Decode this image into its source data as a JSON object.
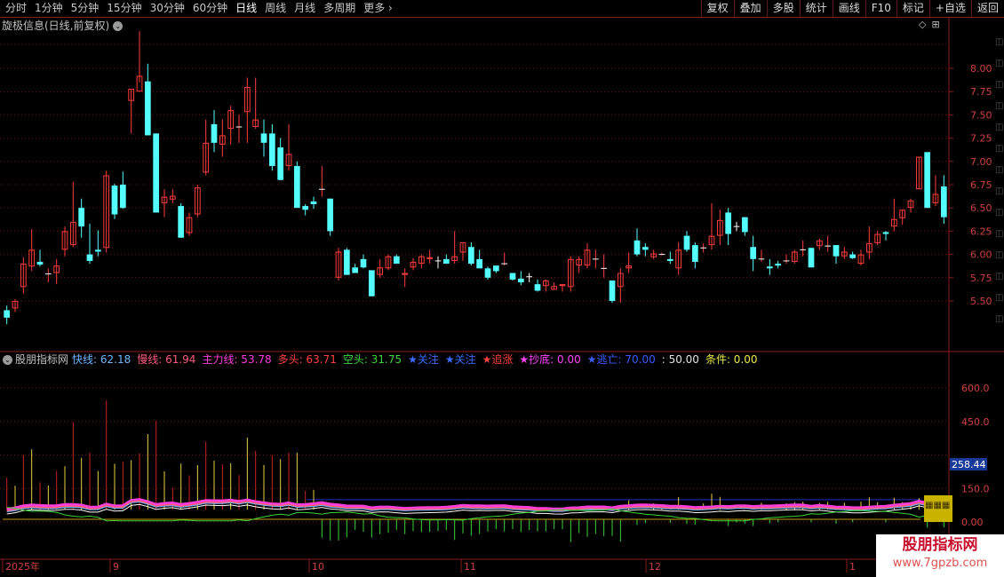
{
  "toolbar": {
    "periods": [
      "分时",
      "1分钟",
      "5分钟",
      "15分钟",
      "30分钟",
      "60分钟",
      "日线",
      "周线",
      "月线",
      "多周期",
      "更多"
    ],
    "active": "日线",
    "buttons": [
      "复权",
      "叠加",
      "多股",
      "统计",
      "画线",
      "F10",
      "标记",
      "+自选",
      "返回"
    ]
  },
  "main_title": "旋极信息(日线,前复权)",
  "main_tools": [
    "◇",
    "⊞"
  ],
  "price_axis": [
    "8.00",
    "7.75",
    "7.50",
    "7.25",
    "7.00",
    "6.75",
    "6.50",
    "6.25",
    "6.00",
    "5.75",
    "5.50"
  ],
  "indicator": {
    "name": "股朋指标网",
    "fields": [
      {
        "text": "快线: 62.18",
        "color": "#6fb7ff"
      },
      {
        "text": "慢线: 61.94",
        "color": "#ff5a7a"
      },
      {
        "text": "主力线: 53.78",
        "color": "#ff3ddc"
      },
      {
        "text": "多头: 63.71",
        "color": "#ff4040"
      },
      {
        "text": "空头: 31.75",
        "color": "#3dd43d"
      },
      {
        "text": "★关注",
        "color": "#3a6bff"
      },
      {
        "text": "★关注",
        "color": "#3a6bff"
      },
      {
        "text": "★追涨",
        "color": "#ff4040"
      },
      {
        "text": "★抄底: 0.00",
        "color": "#ff44ff"
      },
      {
        "text": "★逃亡: 70.00",
        "color": "#3a5cff"
      },
      {
        "text": ": 50.00",
        "color": "#e0e0e0"
      },
      {
        "text": "条件: 0.00",
        "color": "#e8e84a"
      }
    ],
    "axis": [
      "600.0",
      "450.0",
      "150.0",
      "0.00"
    ],
    "current_value": "258.44"
  },
  "dates": [
    "2025年",
    "9",
    "10",
    "11",
    "12",
    "1"
  ],
  "watermark": {
    "title": "股朋指标网",
    "url": "www.7gpzb.com"
  },
  "colors": {
    "up": "#ff3c3c",
    "down": "#54ffff",
    "grid": "#7a1010"
  },
  "chart_data": {
    "type": "candlestick",
    "y_range": [
      5.2,
      8.2
    ],
    "candles": [
      [
        5.4,
        5.45,
        5.25,
        5.32
      ],
      [
        5.42,
        5.52,
        5.38,
        5.5
      ],
      [
        5.65,
        5.97,
        5.58,
        5.9
      ],
      [
        5.87,
        6.27,
        5.82,
        6.05
      ],
      [
        5.92,
        6.05,
        5.87,
        5.89
      ],
      [
        5.79,
        5.85,
        5.7,
        5.79
      ],
      [
        5.8,
        5.95,
        5.68,
        5.88
      ],
      [
        6.05,
        6.3,
        5.98,
        6.25
      ],
      [
        6.1,
        6.78,
        6.08,
        6.35
      ],
      [
        6.5,
        6.6,
        6.18,
        6.3
      ],
      [
        6.0,
        6.33,
        5.9,
        5.93
      ],
      [
        6.05,
        6.26,
        5.98,
        6.03
      ],
      [
        6.07,
        6.9,
        6.02,
        6.85
      ],
      [
        6.74,
        6.76,
        6.38,
        6.43
      ],
      [
        6.75,
        6.89,
        6.49,
        6.5
      ],
      [
        7.65,
        7.77,
        7.3,
        7.78
      ],
      [
        7.75,
        8.4,
        7.85,
        7.92
      ],
      [
        7.86,
        8.05,
        7.28,
        7.28
      ],
      [
        7.3,
        7.3,
        6.45,
        6.45
      ],
      [
        6.55,
        6.7,
        6.4,
        6.62
      ],
      [
        6.59,
        6.7,
        6.55,
        6.63
      ],
      [
        6.52,
        6.55,
        6.18,
        6.18
      ],
      [
        6.23,
        6.45,
        6.2,
        6.4
      ],
      [
        6.43,
        6.75,
        6.4,
        6.72
      ],
      [
        6.88,
        7.45,
        6.85,
        7.2
      ],
      [
        7.4,
        7.55,
        7.1,
        7.2
      ],
      [
        7.18,
        7.45,
        7.05,
        7.28
      ],
      [
        7.35,
        7.6,
        7.18,
        7.55
      ],
      [
        7.37,
        7.5,
        7.2,
        7.37
      ],
      [
        7.53,
        7.9,
        7.2,
        7.8
      ],
      [
        7.37,
        7.9,
        7.35,
        7.45
      ],
      [
        7.3,
        7.45,
        7.05,
        7.2
      ],
      [
        7.3,
        7.4,
        6.9,
        6.95
      ],
      [
        7.15,
        7.25,
        6.8,
        6.8
      ],
      [
        6.95,
        7.4,
        6.9,
        7.08
      ],
      [
        6.95,
        7.0,
        6.5,
        6.5
      ],
      [
        6.52,
        6.54,
        6.42,
        6.48
      ],
      [
        6.57,
        6.62,
        6.49,
        6.54
      ],
      [
        6.7,
        6.95,
        6.62,
        6.7
      ],
      [
        6.6,
        6.6,
        6.2,
        6.25
      ],
      [
        5.75,
        6.07,
        5.72,
        6.03
      ],
      [
        6.05,
        6.07,
        5.78,
        5.78
      ],
      [
        5.86,
        5.9,
        5.8,
        5.8
      ],
      [
        5.95,
        6.0,
        5.85,
        5.86
      ],
      [
        5.83,
        5.83,
        5.55,
        5.55
      ],
      [
        5.78,
        5.95,
        5.75,
        5.86
      ],
      [
        5.85,
        6.0,
        5.83,
        5.98
      ],
      [
        5.98,
        6.0,
        5.9,
        5.9
      ],
      [
        5.78,
        5.85,
        5.65,
        5.8
      ],
      [
        5.86,
        5.96,
        5.83,
        5.92
      ],
      [
        5.9,
        6.0,
        5.85,
        5.98
      ],
      [
        5.95,
        6.05,
        5.9,
        5.97
      ],
      [
        5.93,
        5.98,
        5.85,
        5.92
      ],
      [
        5.95,
        6.0,
        5.9,
        5.9
      ],
      [
        5.93,
        6.25,
        5.9,
        5.98
      ],
      [
        6.02,
        6.12,
        5.93,
        6.13
      ],
      [
        6.08,
        6.13,
        5.88,
        5.9
      ],
      [
        5.95,
        6.05,
        5.85,
        5.85
      ],
      [
        5.85,
        5.87,
        5.73,
        5.75
      ],
      [
        5.88,
        5.88,
        5.8,
        5.82
      ],
      [
        5.9,
        6.02,
        5.88,
        5.9
      ],
      [
        5.8,
        5.8,
        5.72,
        5.73
      ],
      [
        5.74,
        5.82,
        5.67,
        5.7
      ],
      [
        5.76,
        5.8,
        5.7,
        5.75
      ],
      [
        5.68,
        5.73,
        5.6,
        5.61
      ],
      [
        5.66,
        5.73,
        5.6,
        5.72
      ],
      [
        5.62,
        5.7,
        5.62,
        5.66
      ],
      [
        5.66,
        5.68,
        5.6,
        5.68
      ],
      [
        5.65,
        5.98,
        5.6,
        5.95
      ],
      [
        5.88,
        5.98,
        5.8,
        5.95
      ],
      [
        5.88,
        6.12,
        5.85,
        6.05
      ],
      [
        5.95,
        6.05,
        5.85,
        5.95
      ],
      [
        5.85,
        6.0,
        5.75,
        5.85
      ],
      [
        5.72,
        5.72,
        5.48,
        5.5
      ],
      [
        5.65,
        5.85,
        5.48,
        5.8
      ],
      [
        5.85,
        6.02,
        5.8,
        5.88
      ],
      [
        6.15,
        6.28,
        5.98,
        6.0
      ],
      [
        6.08,
        6.12,
        5.98,
        6.05
      ],
      [
        5.97,
        6.05,
        5.95,
        6.01
      ],
      [
        6.0,
        6.02,
        5.99,
        6.0
      ],
      [
        5.95,
        6.03,
        5.9,
        5.93
      ],
      [
        5.85,
        6.13,
        5.78,
        6.05
      ],
      [
        6.2,
        6.25,
        6.03,
        6.05
      ],
      [
        6.1,
        6.13,
        5.85,
        5.92
      ],
      [
        6.07,
        6.12,
        6.02,
        6.07
      ],
      [
        6.1,
        6.55,
        6.05,
        6.2
      ],
      [
        6.2,
        6.48,
        6.1,
        6.37
      ],
      [
        6.45,
        6.5,
        6.1,
        6.22
      ],
      [
        6.3,
        6.35,
        6.25,
        6.29
      ],
      [
        6.4,
        6.4,
        6.2,
        6.24
      ],
      [
        6.08,
        6.2,
        5.82,
        5.95
      ],
      [
        5.95,
        6.05,
        5.92,
        5.95
      ],
      [
        5.87,
        5.95,
        5.78,
        5.85
      ],
      [
        5.9,
        5.93,
        5.85,
        5.88
      ],
      [
        5.93,
        6.0,
        5.9,
        5.93
      ],
      [
        5.92,
        6.05,
        5.9,
        6.03
      ],
      [
        6.05,
        6.15,
        5.98,
        6.05
      ],
      [
        6.07,
        6.07,
        5.98,
        5.86
      ],
      [
        6.09,
        6.17,
        6.05,
        6.15
      ],
      [
        6.08,
        6.2,
        6.03,
        6.09
      ],
      [
        6.1,
        6.1,
        5.9,
        5.98
      ],
      [
        5.98,
        6.08,
        5.95,
        6.03
      ],
      [
        6.0,
        6.03,
        5.95,
        5.96
      ],
      [
        5.9,
        6.05,
        5.88,
        6.0
      ],
      [
        6.02,
        6.3,
        5.95,
        6.12
      ],
      [
        6.12,
        6.25,
        6.1,
        6.22
      ],
      [
        6.24,
        6.25,
        6.15,
        6.22
      ],
      [
        6.3,
        6.6,
        6.25,
        6.38
      ],
      [
        6.39,
        6.48,
        6.32,
        6.48
      ],
      [
        6.5,
        6.6,
        6.45,
        6.58
      ],
      [
        6.7,
        7.05,
        6.7,
        7.05
      ],
      [
        7.1,
        7.1,
        6.5,
        6.5
      ],
      [
        6.55,
        6.85,
        6.52,
        6.65
      ],
      [
        6.73,
        6.85,
        6.33,
        6.4
      ]
    ]
  }
}
